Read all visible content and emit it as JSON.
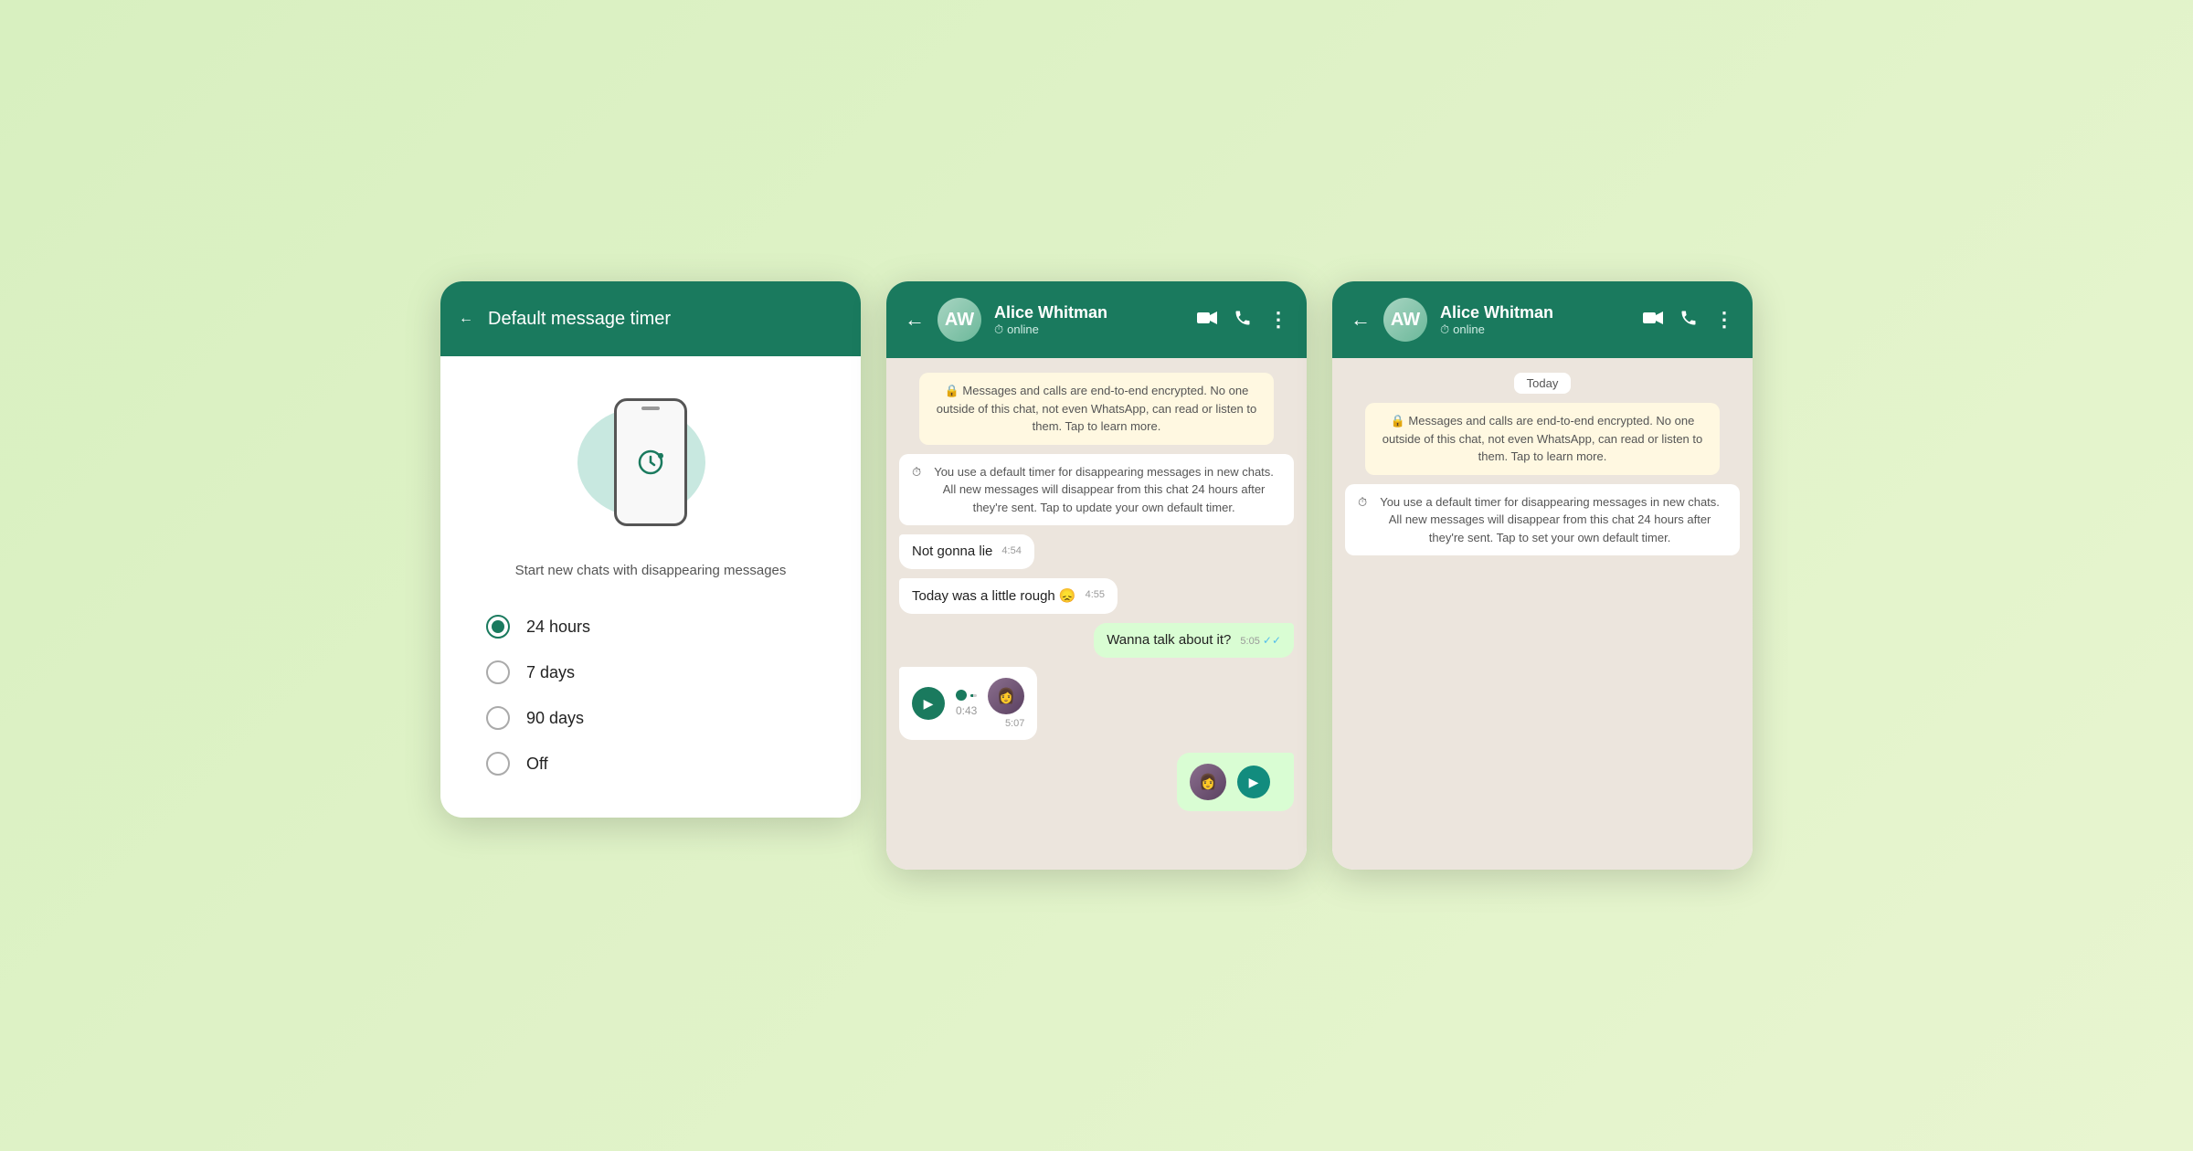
{
  "background": "#d4edba",
  "screens": [
    {
      "id": "timer-screen",
      "type": "settings",
      "header": {
        "back_label": "←",
        "title": "Default message timer"
      },
      "illustration_alt": "phone with timer icon",
      "subtitle": "Start new chats with disappearing messages",
      "options": [
        {
          "id": "24h",
          "label": "24 hours",
          "selected": true
        },
        {
          "id": "7d",
          "label": "7 days",
          "selected": false
        },
        {
          "id": "90d",
          "label": "90 days",
          "selected": false
        },
        {
          "id": "off",
          "label": "Off",
          "selected": false
        }
      ]
    },
    {
      "id": "chat-screen-1",
      "type": "chat",
      "header": {
        "back_label": "←",
        "contact_name": "Alice Whitman",
        "contact_status": "online",
        "video_icon": "📹",
        "phone_icon": "📞",
        "more_icon": "⋮"
      },
      "messages": [
        {
          "id": "sys1",
          "type": "system",
          "text": "🔒 Messages and calls are end-to-end encrypted. No one outside of this chat, not even WhatsApp, can read or listen to them. Tap to learn more."
        },
        {
          "id": "sys2",
          "type": "disappear",
          "text": "You use a default timer for disappearing messages in new chats. All new messages will disappear from this chat 24 hours after they're sent. Tap to update your own default timer."
        },
        {
          "id": "msg1",
          "type": "incoming",
          "text": "Not gonna lie",
          "time": "4:54"
        },
        {
          "id": "msg2",
          "type": "incoming",
          "text": "Today was a little rough 😞",
          "time": "4:55"
        },
        {
          "id": "msg3",
          "type": "outgoing",
          "text": "Wanna talk about it?",
          "time": "5:05",
          "ticks": "✓✓"
        },
        {
          "id": "voice1",
          "type": "voice_incoming",
          "duration": "0:43",
          "time": "5:07"
        },
        {
          "id": "voice2",
          "type": "voice_outgoing_partial"
        }
      ]
    },
    {
      "id": "chat-screen-2",
      "type": "chat",
      "header": {
        "back_label": "←",
        "contact_name": "Alice Whitman",
        "contact_status": "online",
        "video_icon": "📹",
        "phone_icon": "📞",
        "more_icon": "⋮"
      },
      "messages": [
        {
          "id": "today",
          "type": "today_badge",
          "text": "Today"
        },
        {
          "id": "sys1",
          "type": "system",
          "text": "🔒 Messages and calls are end-to-end encrypted. No one outside of this chat, not even WhatsApp, can read or listen to them. Tap to learn more."
        },
        {
          "id": "sys2",
          "type": "disappear",
          "text": "You use a default timer for disappearing messages in new chats. All new messages will disappear from this chat 24 hours after they're sent. Tap to set your own default timer."
        }
      ]
    }
  ]
}
